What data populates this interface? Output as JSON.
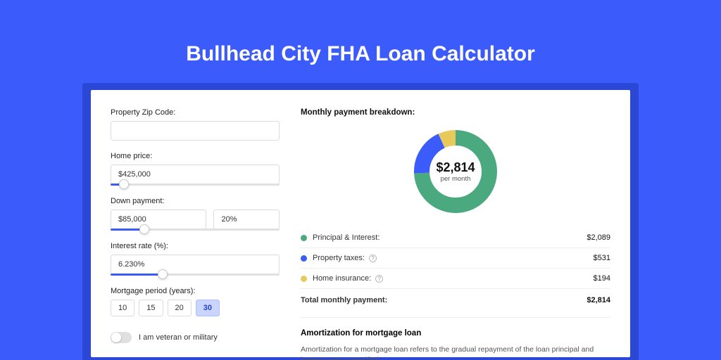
{
  "title": "Bullhead City FHA Loan Calculator",
  "form": {
    "zip": {
      "label": "Property Zip Code:",
      "value": ""
    },
    "price": {
      "label": "Home price:",
      "value": "$425,000",
      "slider_pct": 8
    },
    "down": {
      "label": "Down payment:",
      "value": "$85,000",
      "pct": "20%",
      "slider_pct": 20
    },
    "rate": {
      "label": "Interest rate (%):",
      "value": "6.230%",
      "slider_pct": 31
    },
    "period": {
      "label": "Mortgage period (years):",
      "options": [
        "10",
        "15",
        "20",
        "30"
      ],
      "active": "30"
    },
    "vet": {
      "label": "I am veteran or military"
    }
  },
  "breakdown": {
    "heading": "Monthly payment breakdown:",
    "center_value": "$2,814",
    "center_sub": "per month",
    "rows": [
      {
        "label": "Principal & Interest:",
        "value": "$2,089",
        "color": "green"
      },
      {
        "label": "Property taxes:",
        "value": "$531",
        "color": "blue",
        "info": true
      },
      {
        "label": "Home insurance:",
        "value": "$194",
        "color": "yellow",
        "info": true
      }
    ],
    "total": {
      "label": "Total monthly payment:",
      "value": "$2,814"
    }
  },
  "chart_data": {
    "type": "pie",
    "title": "Monthly payment breakdown",
    "series": [
      {
        "name": "Principal & Interest",
        "value": 2089,
        "color": "#4BA97F"
      },
      {
        "name": "Property taxes",
        "value": 531,
        "color": "#3B5BFB"
      },
      {
        "name": "Home insurance",
        "value": 194,
        "color": "#E8C95C"
      }
    ],
    "total": 2814
  },
  "amort": {
    "heading": "Amortization for mortgage loan",
    "text": "Amortization for a mortgage loan refers to the gradual repayment of the loan principal and interest over a specified"
  }
}
